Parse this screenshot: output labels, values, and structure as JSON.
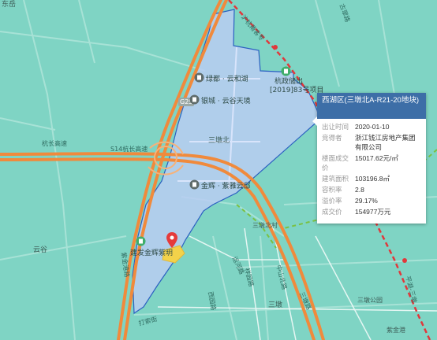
{
  "map": {
    "colors": {
      "land": "#7fd4c4",
      "parcel_fill": "#b9cdf2",
      "parcel_stroke": "#2a5fc1",
      "expressway": "#f08a3c",
      "railway_red": "#e0383b",
      "railway_green": "#7ac143",
      "popup_header": "#3d6ea7"
    },
    "area_labels": {
      "top_left": "东岳",
      "sanduobei": "三墩北",
      "yungu": "云谷",
      "sandun": "三墩",
      "sandun_park": "三墩公园",
      "jinhui": "三墩北村",
      "zijin": "紫金港"
    },
    "road_labels": {
      "hangchang": "杭长高速",
      "s14a": "S14杭长高速",
      "g25": "G25",
      "s14b": "S14杭长高速",
      "xiwen": "西园路",
      "dingxin": "打索街",
      "zijingang": "紫金港路",
      "yunhe": "运河路",
      "xiangyuan": "祥园路",
      "zhongshan": "中山北路",
      "sandun_rd": "三墩路",
      "guzhu": "古翠路",
      "xixi": "西溪路",
      "top_rail": "沪杭甬客专",
      "pinghu": "平湖-三墩"
    },
    "pois": {
      "lvdu": "绿都 · 云和湖",
      "yincheng": "银城 · 云谷天境",
      "jinhui": "金辉 · 紫雅云邸",
      "jianfa": "建发金辉紫玥",
      "hangzheng": "杭政储出",
      "hangzheng2": "[2019]83号项目"
    }
  },
  "popup": {
    "title": "西湖区(三墩北A-R21-20地块)",
    "rows": [
      {
        "key": "出让时间",
        "value": "2020-01-10"
      },
      {
        "key": "竞得者",
        "value": "浙江钱江房地产集团有限公司"
      },
      {
        "key": "楼面成交价",
        "value": "15017.62元/㎡"
      },
      {
        "key": "建筑面积",
        "value": "103196.8㎡"
      },
      {
        "key": "容积率",
        "value": "2.8"
      },
      {
        "key": "溢价率",
        "value": "29.17%"
      },
      {
        "key": "成交价",
        "value": "154977万元"
      }
    ]
  }
}
